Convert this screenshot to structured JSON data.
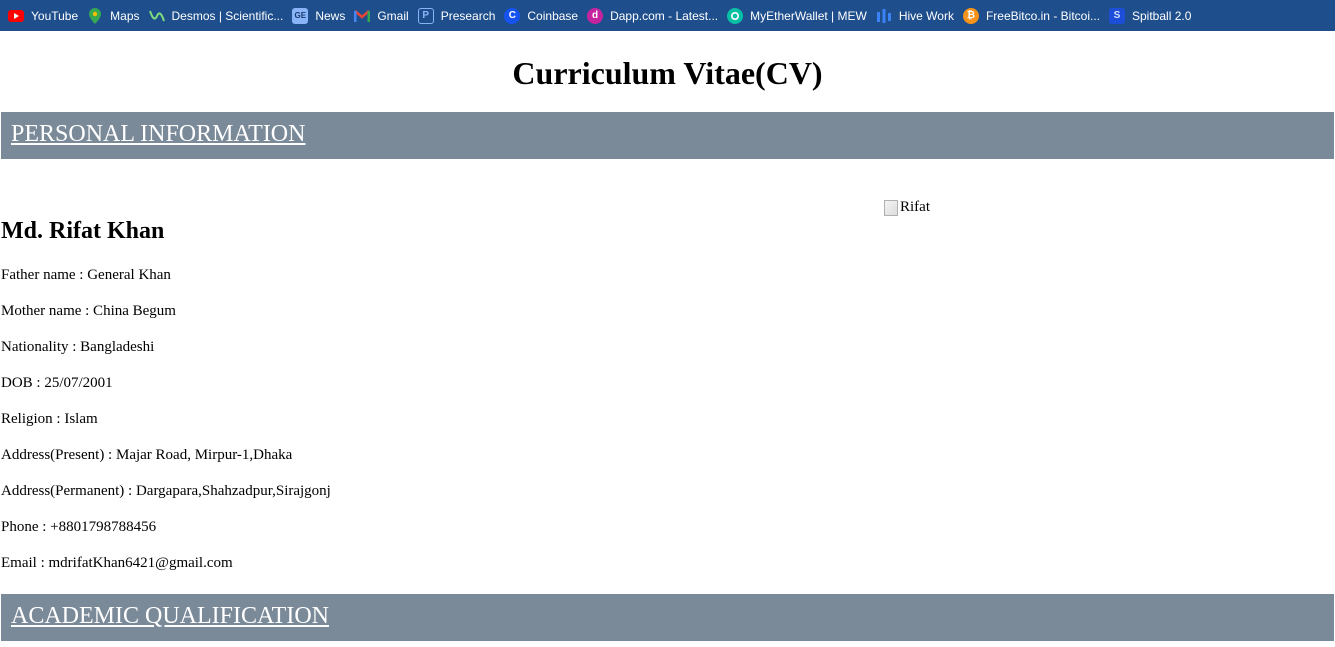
{
  "bookmarks": [
    {
      "label": "YouTube",
      "icon": "youtube-icon",
      "color": "#ff0000"
    },
    {
      "label": "Maps",
      "icon": "maps-icon",
      "color": "#34a853"
    },
    {
      "label": "Desmos | Scientific...",
      "icon": "desmos-icon",
      "color": "#2f7d32"
    },
    {
      "label": "News",
      "icon": "news-icon",
      "color": "#4285f4"
    },
    {
      "label": "Gmail",
      "icon": "gmail-icon",
      "color": "#ea4335"
    },
    {
      "label": "Presearch",
      "icon": "presearch-icon",
      "color": "#2d6fe0"
    },
    {
      "label": "Coinbase",
      "icon": "coinbase-icon",
      "color": "#1652f0"
    },
    {
      "label": "Dapp.com - Latest...",
      "icon": "dapp-icon",
      "color": "#c4249d"
    },
    {
      "label": "MyEtherWallet | MEW",
      "icon": "mew-icon",
      "color": "#05c0a5"
    },
    {
      "label": "Hive Work",
      "icon": "hive-icon",
      "color": "#3b82f6"
    },
    {
      "label": "FreeBitco.in - Bitcoi...",
      "icon": "bitcoin-icon",
      "color": "#f7931a"
    },
    {
      "label": "Spitball 2.0",
      "icon": "spitball-icon",
      "color": "#1d4ed8"
    }
  ],
  "page": {
    "title": "Curriculum Vitae(CV)",
    "sections": {
      "personal": "PERSONAL INFORMATION",
      "academic": "ACADEMIC QUALIFICATION"
    },
    "name": "Md. Rifat Khan",
    "photo_alt": "Rifat",
    "info": [
      "Father name : General Khan",
      "Mother name : China Begum",
      "Nationality : Bangladeshi",
      "DOB : 25/07/2001",
      "Religion : Islam",
      "Address(Present) : Majar Road, Mirpur-1,Dhaka",
      "Address(Permanent) : Dargapara,Shahzadpur,Sirajgonj",
      "Phone : +8801798788456",
      "Email : mdrifatKhan6421@gmail.com"
    ]
  },
  "colors": {
    "bookmark_bar": "#1e4e8c",
    "section_bar": "#7b8a99"
  }
}
